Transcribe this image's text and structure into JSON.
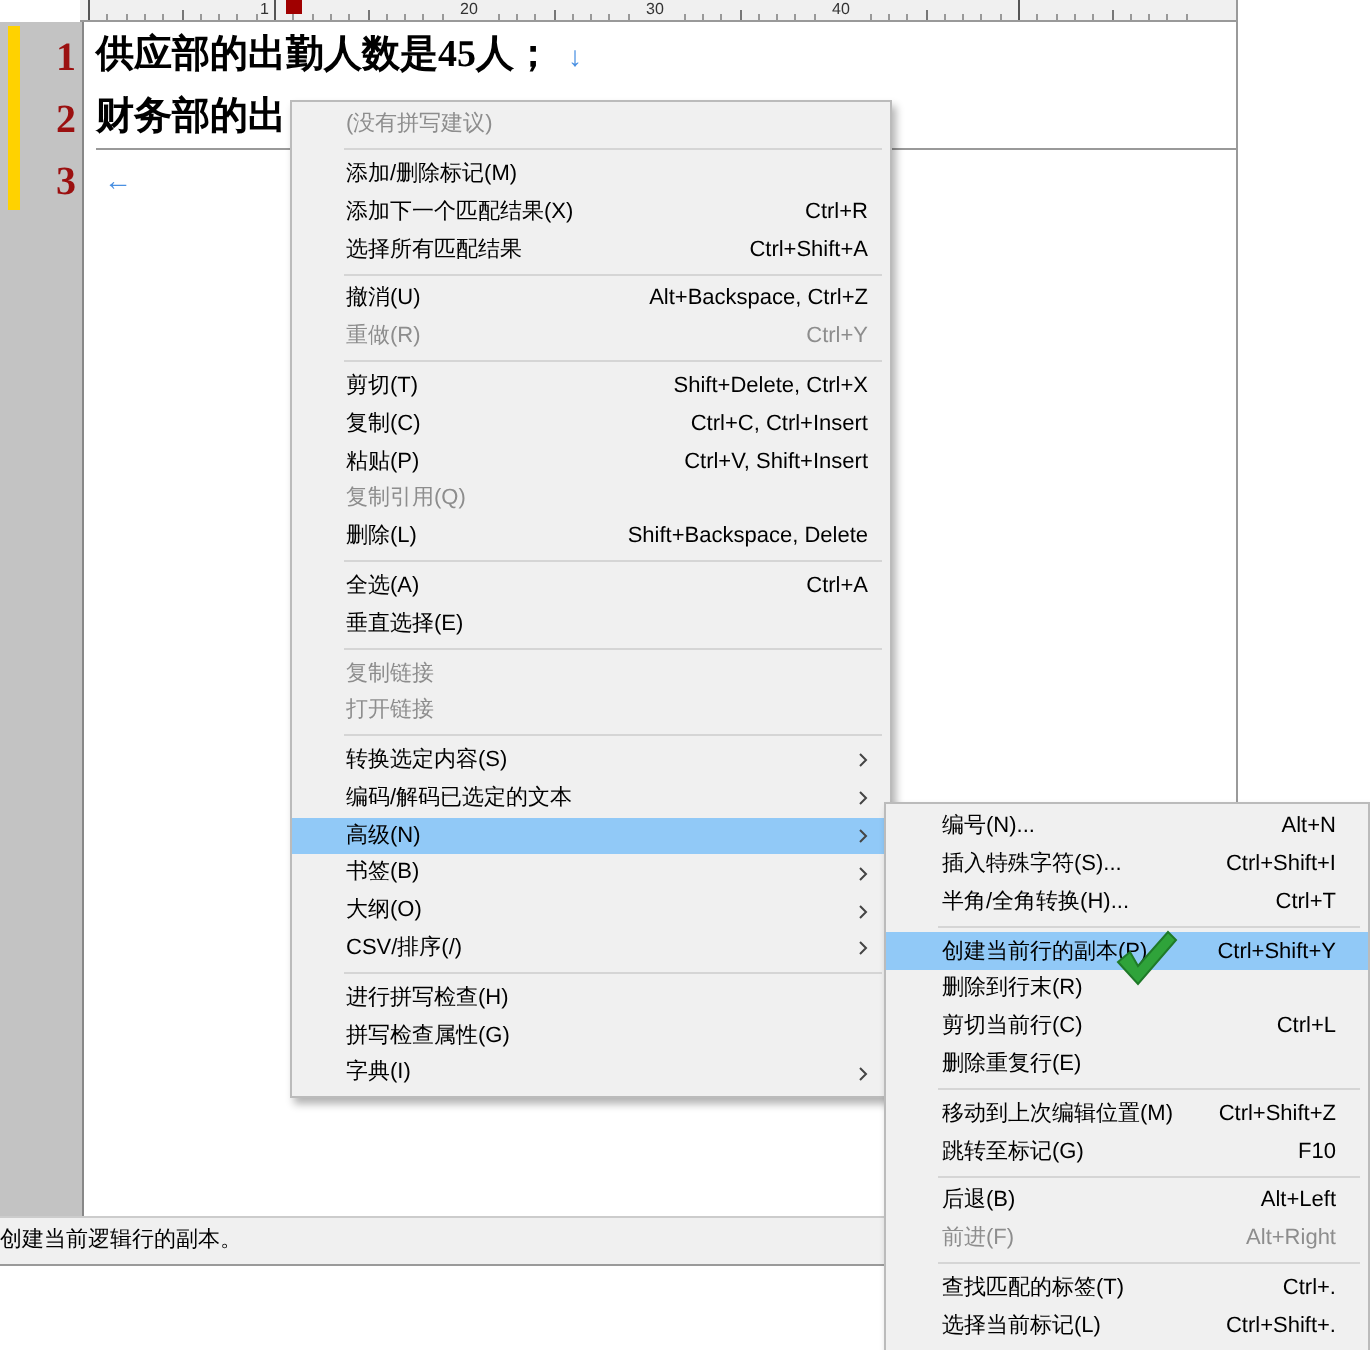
{
  "ruler": {
    "labels": [
      "1",
      "20",
      "30",
      "40"
    ]
  },
  "editor": {
    "lines": [
      {
        "number": "1",
        "text": "供应部的出勤人数是45人；",
        "end_mark": "↓"
      },
      {
        "number": "2",
        "text": "财务部的出"
      },
      {
        "number": "3",
        "end_mark": "←"
      }
    ]
  },
  "context_menu": {
    "groups": [
      [
        {
          "label": "(没有拼写建议)",
          "disabled": true,
          "selected": false,
          "has_submenu": false
        }
      ],
      [
        {
          "label": "添加/删除标记(M)",
          "disabled": false,
          "selected": false,
          "has_submenu": false
        },
        {
          "label": "添加下一个匹配结果(X)",
          "shortcut": "Ctrl+R",
          "disabled": false,
          "selected": false,
          "has_submenu": false
        },
        {
          "label": "选择所有匹配结果",
          "shortcut": "Ctrl+Shift+A",
          "disabled": false,
          "selected": false,
          "has_submenu": false
        }
      ],
      [
        {
          "label": "撤消(U)",
          "shortcut": "Alt+Backspace, Ctrl+Z",
          "disabled": false,
          "selected": false,
          "has_submenu": false
        },
        {
          "label": "重做(R)",
          "shortcut": "Ctrl+Y",
          "disabled": true,
          "selected": false,
          "has_submenu": false
        }
      ],
      [
        {
          "label": "剪切(T)",
          "shortcut": "Shift+Delete, Ctrl+X",
          "disabled": false,
          "selected": false,
          "has_submenu": false
        },
        {
          "label": "复制(C)",
          "shortcut": "Ctrl+C, Ctrl+Insert",
          "disabled": false,
          "selected": false,
          "has_submenu": false
        },
        {
          "label": "粘贴(P)",
          "shortcut": "Ctrl+V, Shift+Insert",
          "disabled": false,
          "selected": false,
          "has_submenu": false
        },
        {
          "label": "复制引用(Q)",
          "disabled": true,
          "selected": false,
          "has_submenu": false
        },
        {
          "label": "删除(L)",
          "shortcut": "Shift+Backspace, Delete",
          "disabled": false,
          "selected": false,
          "has_submenu": false
        }
      ],
      [
        {
          "label": "全选(A)",
          "shortcut": "Ctrl+A",
          "disabled": false,
          "selected": false,
          "has_submenu": false
        },
        {
          "label": "垂直选择(E)",
          "disabled": false,
          "selected": false,
          "has_submenu": false
        }
      ],
      [
        {
          "label": "复制链接",
          "disabled": true,
          "selected": false,
          "has_submenu": false
        },
        {
          "label": "打开链接",
          "disabled": true,
          "selected": false,
          "has_submenu": false
        }
      ],
      [
        {
          "label": "转换选定内容(S)",
          "disabled": false,
          "selected": false,
          "has_submenu": true
        },
        {
          "label": "编码/解码已选定的文本",
          "disabled": false,
          "selected": false,
          "has_submenu": true
        },
        {
          "label": "高级(N)",
          "disabled": false,
          "selected": true,
          "has_submenu": true
        },
        {
          "label": "书签(B)",
          "disabled": false,
          "selected": false,
          "has_submenu": true
        },
        {
          "label": "大纲(O)",
          "disabled": false,
          "selected": false,
          "has_submenu": true
        },
        {
          "label": "CSV/排序(/)",
          "disabled": false,
          "selected": false,
          "has_submenu": true
        }
      ],
      [
        {
          "label": "进行拼写检查(H)",
          "disabled": false,
          "selected": false,
          "has_submenu": false
        },
        {
          "label": "拼写检查属性(G)",
          "disabled": false,
          "selected": false,
          "has_submenu": false
        },
        {
          "label": "字典(I)",
          "disabled": false,
          "selected": false,
          "has_submenu": true
        }
      ]
    ]
  },
  "submenu": {
    "groups": [
      [
        {
          "label": "编号(N)...",
          "shortcut": "Alt+N",
          "disabled": false,
          "selected": false
        },
        {
          "label": "插入特殊字符(S)...",
          "shortcut": "Ctrl+Shift+I",
          "disabled": false,
          "selected": false
        },
        {
          "label": "半角/全角转换(H)...",
          "shortcut": "Ctrl+T",
          "disabled": false,
          "selected": false
        }
      ],
      [
        {
          "label": "创建当前行的副本(P)",
          "shortcut": "Ctrl+Shift+Y",
          "disabled": false,
          "selected": true
        },
        {
          "label": "删除到行末(R)",
          "disabled": false,
          "selected": false
        },
        {
          "label": "剪切当前行(C)",
          "shortcut": "Ctrl+L",
          "disabled": false,
          "selected": false
        },
        {
          "label": "删除重复行(E)",
          "disabled": false,
          "selected": false
        }
      ],
      [
        {
          "label": "移动到上次编辑位置(M)",
          "shortcut": "Ctrl+Shift+Z",
          "disabled": false,
          "selected": false
        },
        {
          "label": "跳转至标记(G)",
          "shortcut": "F10",
          "disabled": false,
          "selected": false
        }
      ],
      [
        {
          "label": "后退(B)",
          "shortcut": "Alt+Left",
          "disabled": false,
          "selected": false
        },
        {
          "label": "前进(F)",
          "shortcut": "Alt+Right",
          "disabled": true,
          "selected": false
        }
      ],
      [
        {
          "label": "查找匹配的标签(T)",
          "shortcut": "Ctrl+.",
          "disabled": false,
          "selected": false
        },
        {
          "label": "选择当前标记(L)",
          "shortcut": "Ctrl+Shift+.",
          "disabled": false,
          "selected": false
        }
      ]
    ]
  },
  "status_bar": {
    "text": "创建当前逻辑行的副本。"
  }
}
